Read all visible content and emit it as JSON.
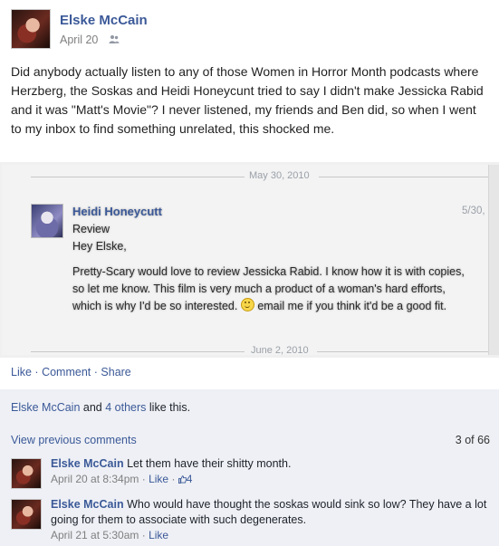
{
  "post": {
    "author": "Elske McCain",
    "date": "April 20",
    "body": "Did anybody actually listen to any of those Women in Horror Month podcasts where Herzberg, the Soskas and Heidi Honeycunt tried to say I didn't make Jessicka Rabid and it was \"Matt's Movie\"? I never listened, my friends and Ben did, so when I went to my inbox to find something unrelated, this shocked me."
  },
  "screenshot": {
    "divider_top": "May 30, 2010",
    "sender": "Heidi Honeycutt",
    "date": "5/30,",
    "subject": "Review",
    "greeting": "Hey Elske,",
    "text_before_smiley": "Pretty-Scary would love to review Jessicka Rabid. I know how it is with copies, so let me know. This film is very much a product of a woman's hard efforts, which is why I'd be so interested.",
    "text_after_smiley": "email me if you think it'd be a good fit.",
    "divider_bottom": "June 2, 2010"
  },
  "actions": {
    "like": "Like",
    "comment": "Comment",
    "share": "Share",
    "separator": "·"
  },
  "likes": {
    "name": "Elske McCain",
    "connector": "and",
    "others": "4 others",
    "suffix": "like this."
  },
  "comments": {
    "view_previous": "View previous comments",
    "count": "3 of 66",
    "items": [
      {
        "author": "Elske McCain",
        "text": "Let them have their shitty month.",
        "time": "April 20 at 8:34pm",
        "like": "Like",
        "likes": "4"
      },
      {
        "author": "Elske McCain",
        "text": "Who would have thought the soskas would sink so low? They have a lot going for them to associate with such degenerates.",
        "time": "April 21 at 5:30am",
        "like": "Like"
      }
    ]
  },
  "icons": {
    "audience": "friends-icon",
    "like_count": "thumbs-up-icon",
    "emoticon": "smiley-icon"
  },
  "colors": {
    "link": "#3b5998",
    "meta": "#7f7f7f",
    "panel": "#eef0f5"
  }
}
